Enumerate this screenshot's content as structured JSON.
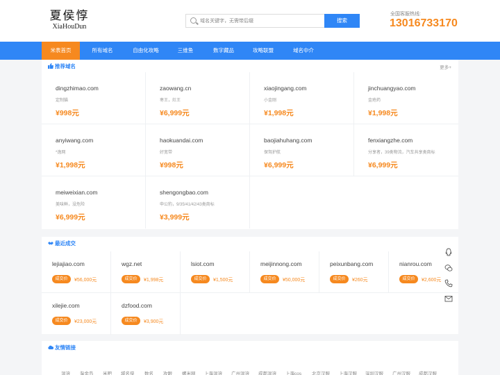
{
  "header": {
    "logo_cn": "夏侯惇",
    "logo_en": "XiaHouDun",
    "search_placeholder": "域名关键字，无需带后缀",
    "search_button": "搜索",
    "hotline_label": "全国客服热线:",
    "hotline_number": "13016733170"
  },
  "nav": [
    {
      "label": "米表首页",
      "active": true
    },
    {
      "label": "所有域名",
      "active": false
    },
    {
      "label": "自由化攻略",
      "active": false
    },
    {
      "label": "三维鱼",
      "active": false
    },
    {
      "label": "数字藏品",
      "active": false
    },
    {
      "label": "攻略联盟",
      "active": false
    },
    {
      "label": "域名中介",
      "active": false
    }
  ],
  "recommended": {
    "title": "推荐域名",
    "more": "更多+",
    "items": [
      {
        "domain": "dingzhimao.com",
        "desc": "定制猫",
        "price": "¥998元"
      },
      {
        "domain": "zaowang.cn",
        "desc": "枣王，灶王",
        "price": "¥6,999元"
      },
      {
        "domain": "xiaojingang.com",
        "desc": "小金刚",
        "price": "¥1,998元"
      },
      {
        "domain": "jinchuangyao.com",
        "desc": "金疮药",
        "price": "¥1,998元"
      },
      {
        "domain": "anyiwang.com",
        "desc": "*逸网",
        "price": "¥1,998元"
      },
      {
        "domain": "haokuandai.com",
        "desc": "好宽带",
        "price": "¥998元"
      },
      {
        "domain": "baojiahuhang.com",
        "desc": "保驾护航",
        "price": "¥6,999元"
      },
      {
        "domain": "fenxiangzhe.com",
        "desc": "分享者，39类物流，汽车共享类商标",
        "price": "¥6,999元"
      },
      {
        "domain": "meiweixian.com",
        "desc": "美味鲜，没危险",
        "price": "¥6,999元"
      },
      {
        "domain": "shengongbao.com",
        "desc": "申公豹，9/35/41/42/43类商标",
        "price": "¥3,999元"
      }
    ]
  },
  "recent": {
    "title": "最近成交",
    "badge": "成交价",
    "items": [
      {
        "domain": "lejiajiao.com",
        "price": "¥56,000元"
      },
      {
        "domain": "wgz.net",
        "price": "¥1,998元"
      },
      {
        "domain": "lsiot.com",
        "price": "¥1,500元"
      },
      {
        "domain": "meijinnong.com",
        "price": "¥50,000元"
      },
      {
        "domain": "peixunbang.com",
        "price": "¥260元"
      },
      {
        "domain": "nianrou.com",
        "price": "¥2,600元"
      },
      {
        "domain": "xilejie.com",
        "price": "¥23,000元"
      },
      {
        "domain": "dzfood.com",
        "price": "¥3,900元"
      }
    ]
  },
  "links": {
    "title": "友情链接",
    "items": [
      "湿溶",
      "淘金岛",
      "米吧",
      "域名侠",
      "数名",
      "攻眼",
      "螺米网",
      "上海湿溶",
      "广州湿溶",
      "成都湿溶",
      "上海cos",
      "北京汉服",
      "上海汉服",
      "深圳汉服",
      "广州汉服",
      "成都汉服"
    ]
  },
  "side_icons": [
    "qq-icon",
    "wechat-icon",
    "phone-icon",
    "mail-icon"
  ],
  "colors": {
    "primary": "#2f86f6",
    "accent": "#f6891f"
  }
}
